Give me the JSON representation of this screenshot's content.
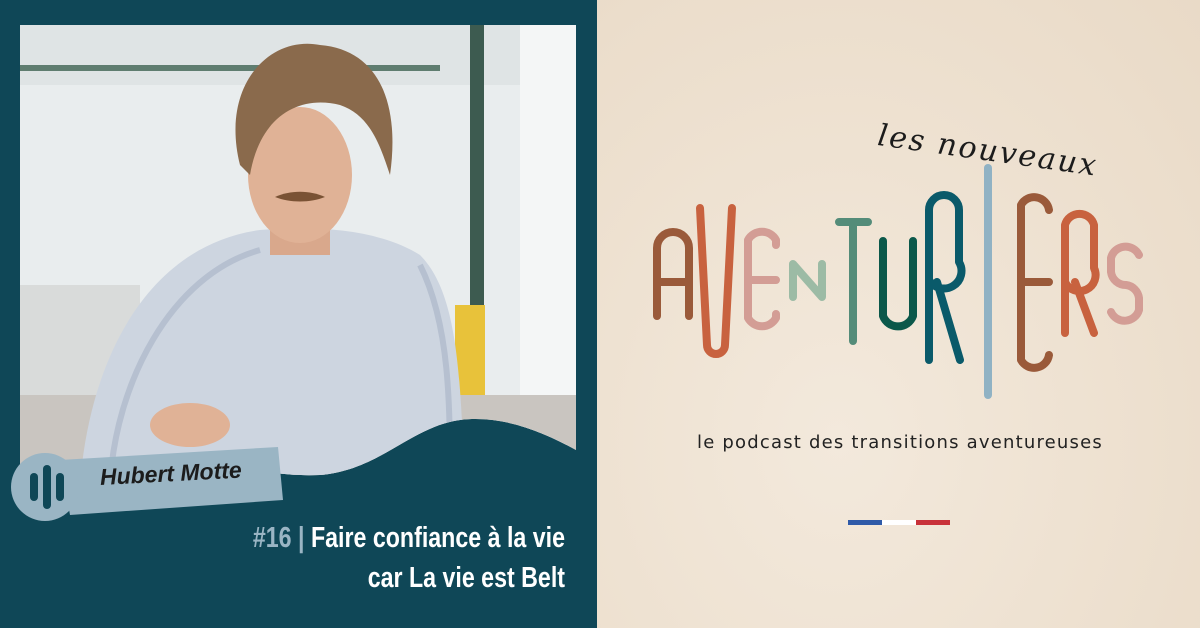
{
  "guest": {
    "name": "Hubert Motte"
  },
  "episode": {
    "number": "#16",
    "separator": "|",
    "title_line1": "Faire confiance à la vie",
    "title_line2": "car La vie est Belt"
  },
  "brand": {
    "logo_prefix": "les nouveaux",
    "logo_word": "AVENTURIERS",
    "tagline": "le podcast des transitions aventureuses",
    "colors": {
      "teal_dark": "#0f4757",
      "tag_blue": "#9ab5c4",
      "brown": "#9a5a3a",
      "orange": "#c8623f",
      "pink": "#d39d95",
      "sage": "#9cbba5",
      "green": "#548c79",
      "forest": "#0b584a",
      "petrol": "#0a5a6a",
      "bar_blue": "#90b2c4"
    }
  },
  "flag": {
    "colors": [
      "#2f5aa8",
      "#ffffff",
      "#c8323a"
    ]
  }
}
